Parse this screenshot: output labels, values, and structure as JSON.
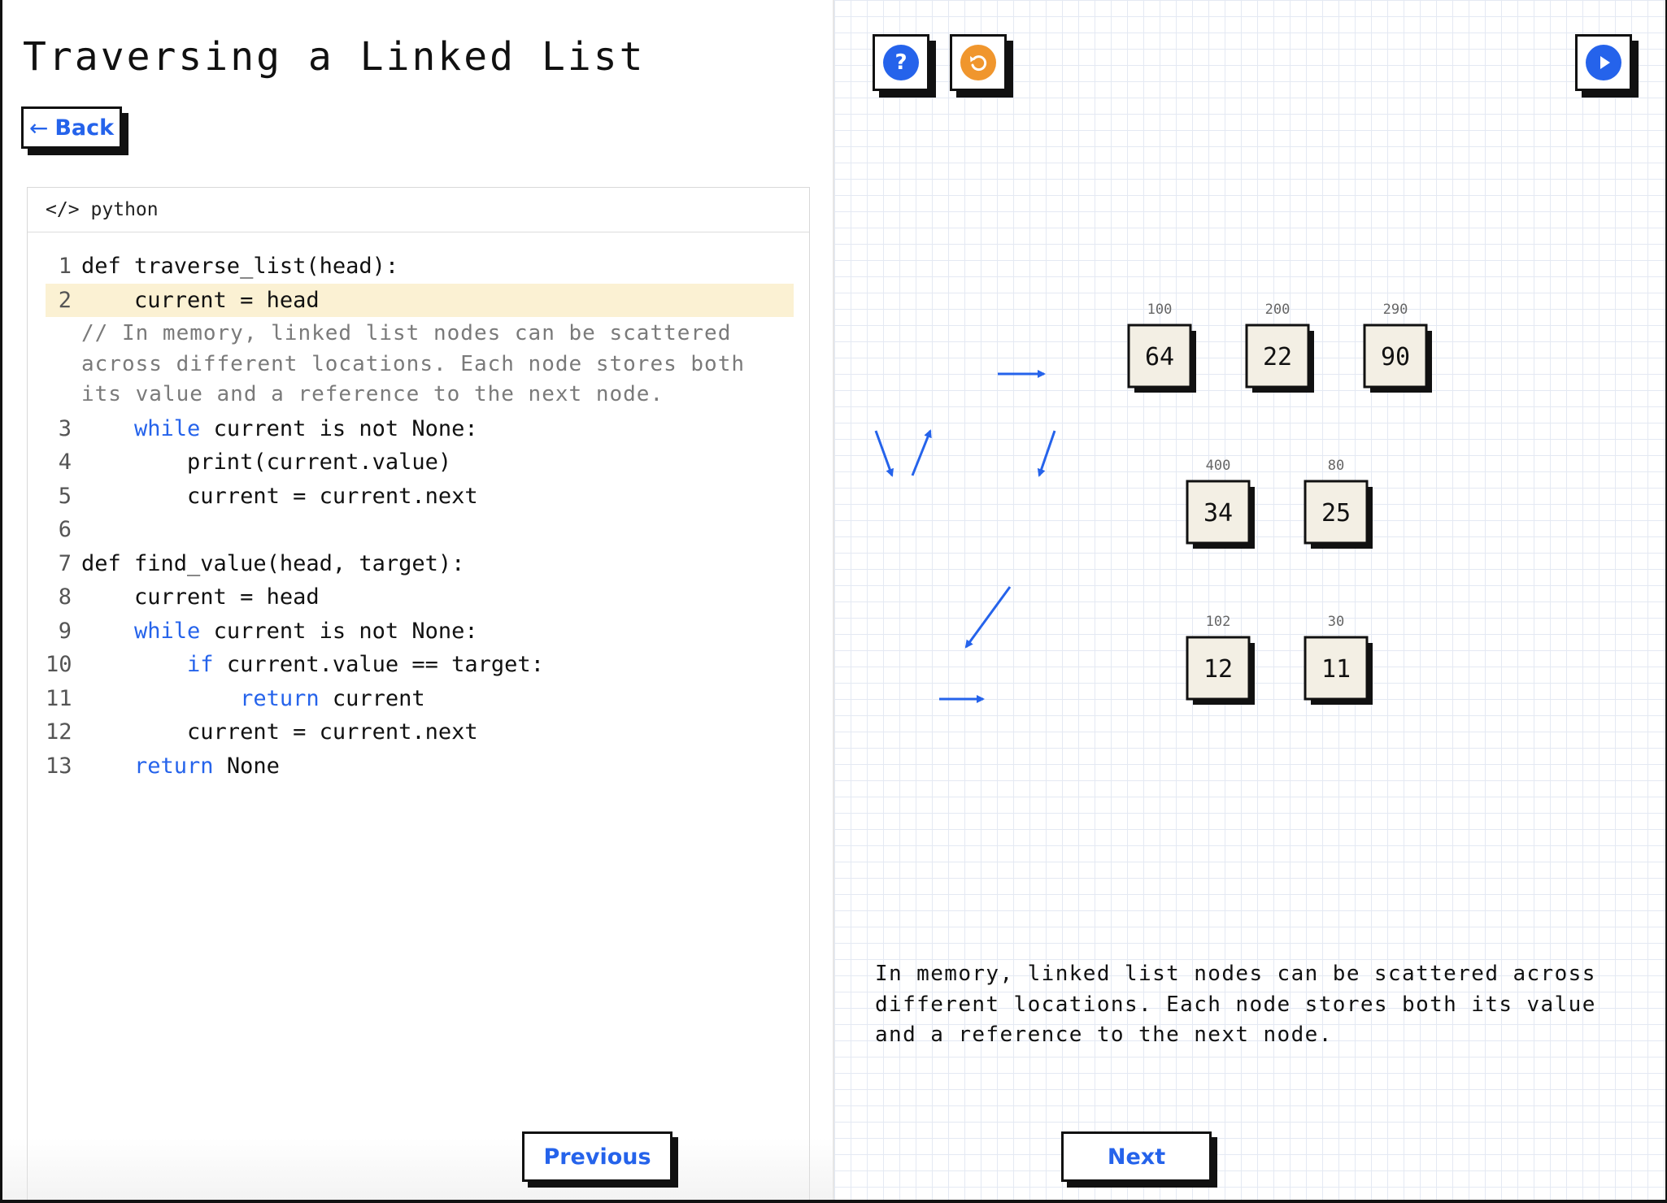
{
  "title": "Traversing a Linked List",
  "back_label": "Back",
  "code": {
    "language": "python",
    "lines": [
      {
        "n": "1",
        "text": "def traverse_list(head):"
      },
      {
        "n": "2",
        "text": "    current = head",
        "active": true
      },
      {
        "comment": "// In memory, linked list nodes can be scattered across different locations. Each node stores both its value and a reference to the next node."
      },
      {
        "n": "3",
        "indent": "    ",
        "kw": "while",
        "rest": " current is not None:"
      },
      {
        "n": "4",
        "text": "        print(current.value)"
      },
      {
        "n": "5",
        "text": "        current = current.next"
      },
      {
        "n": "6",
        "text": ""
      },
      {
        "n": "7",
        "text": "def find_value(head, target):"
      },
      {
        "n": "8",
        "text": "    current = head"
      },
      {
        "n": "9",
        "indent": "    ",
        "kw": "while",
        "rest": " current is not None:"
      },
      {
        "n": "10",
        "indent": "        ",
        "kw": "if",
        "rest": " current.value == target:"
      },
      {
        "n": "11",
        "indent": "            ",
        "kw": "return",
        "rest": " current"
      },
      {
        "n": "12",
        "text": "        current = current.next"
      },
      {
        "n": "13",
        "indent": "    ",
        "kw": "return",
        "rest": " None"
      }
    ]
  },
  "nodes": [
    {
      "addr": "100",
      "value": "64"
    },
    {
      "addr": "200",
      "value": "22"
    },
    {
      "addr": "290",
      "value": "90"
    },
    {
      "addr": "400",
      "value": "34"
    },
    {
      "addr": "80",
      "value": "25"
    },
    {
      "addr": "102",
      "value": "12"
    },
    {
      "addr": "30",
      "value": "11"
    }
  ],
  "description": "In memory, linked list nodes can be scattered across different locations. Each node stores both its value and a reference to the next node.",
  "buttons": {
    "previous": "Previous",
    "next": "Next",
    "help": "?"
  },
  "colors": {
    "accent": "#2563eb",
    "reset": "#f0962d",
    "highlight": "#fbf1d3"
  }
}
